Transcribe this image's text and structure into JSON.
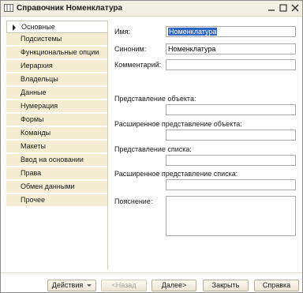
{
  "window": {
    "title": "Справочник Номенклатура"
  },
  "sidebar": {
    "items": [
      {
        "label": "Основные",
        "active": true
      },
      {
        "label": "Подсистемы",
        "active": false
      },
      {
        "label": "Функциональные опции",
        "active": false
      },
      {
        "label": "Иерархия",
        "active": false
      },
      {
        "label": "Владельцы",
        "active": false
      },
      {
        "label": "Данные",
        "active": false
      },
      {
        "label": "Нумерация",
        "active": false
      },
      {
        "label": "Формы",
        "active": false
      },
      {
        "label": "Команды",
        "active": false
      },
      {
        "label": "Макеты",
        "active": false
      },
      {
        "label": "Ввод на основании",
        "active": false
      },
      {
        "label": "Права",
        "active": false
      },
      {
        "label": "Обмен данными",
        "active": false
      },
      {
        "label": "Прочее",
        "active": false
      }
    ]
  },
  "form": {
    "name_label": "Имя:",
    "name_value": "Номенклатура",
    "synonym_label": "Синоним:",
    "synonym_value": "Номенклатура",
    "comment_label": "Комментарий:",
    "comment_value": "",
    "object_presentation_label": "Представление объекта:",
    "object_presentation_value": "",
    "ext_object_presentation_label": "Расширенное представление объекта:",
    "ext_object_presentation_value": "",
    "list_presentation_label": "Представление списка:",
    "list_presentation_value": "",
    "ext_list_presentation_label": "Расширенное представление списка:",
    "ext_list_presentation_value": "",
    "explanation_label": "Пояснение:",
    "explanation_value": ""
  },
  "buttons": {
    "actions": "Действия",
    "back": "<Назад",
    "next": "Далее>",
    "close": "Закрыть",
    "help": "Справка"
  },
  "colors": {
    "sidebar_bg": "#f4edd1",
    "selection": "#3163c5",
    "titlebar_bg": "#f2efe4"
  }
}
